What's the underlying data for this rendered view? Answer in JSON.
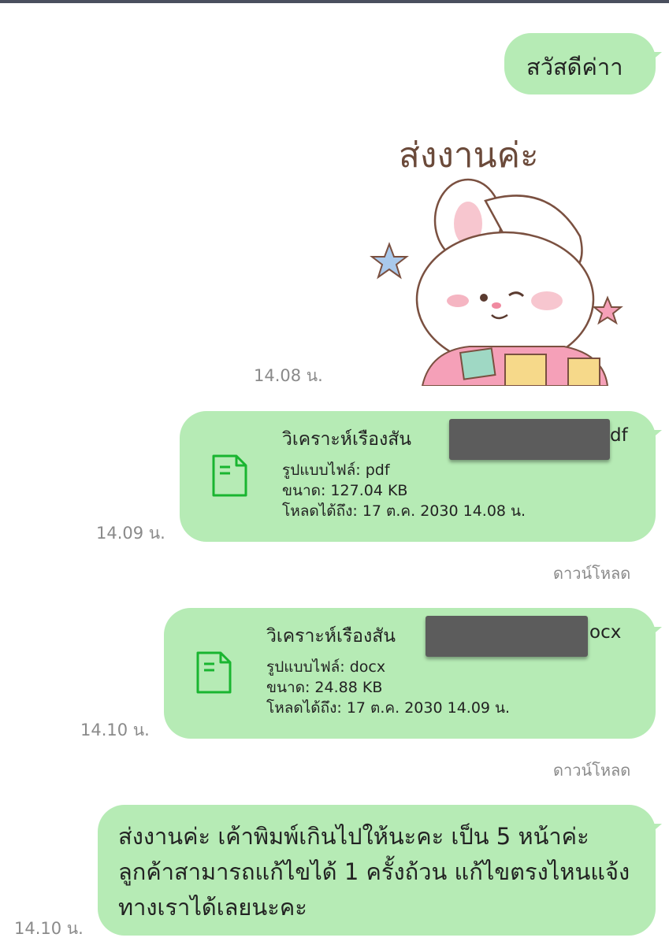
{
  "messages": [
    {
      "id": "greeting",
      "text": "สวัสดีค่าา"
    },
    {
      "id": "sticker",
      "text": "ส่งงานค่ะ",
      "time": "14.08 น."
    },
    {
      "id": "file1",
      "title_visible": "วิเคราะห์เรืองสัน",
      "suffix": "df",
      "type_line": "รูปแบบไฟล์: pdf",
      "size_line": "ขนาด: 127.04 KB",
      "expiry_line": "โหลดได้ถึง: 17 ต.ค. 2030 14.08 น.",
      "time": "14.09 น.",
      "download_label": "ดาวน์โหลด"
    },
    {
      "id": "file2",
      "title_visible": "วิเคราะห์เรืองสัน",
      "suffix": "ocx",
      "type_line": "รูปแบบไฟล์: docx",
      "size_line": "ขนาด: 24.88 KB",
      "expiry_line": "โหลดได้ถึง: 17 ต.ค. 2030 14.09 น.",
      "time": "14.10 น.",
      "download_label": "ดาวน์โหลด"
    },
    {
      "id": "note",
      "text": "ส่งงานค่ะ เค้าพิมพ์เกินไปให้นะคะ เป็น 5 หน้าค่ะ ลูกค้าสามารถแก้ไขได้ 1 ครั้งถ้วน แก้ไขตรงไหนแจ้งทางเราได้เลยนะคะ",
      "time": "14.10 น."
    }
  ],
  "colors": {
    "bubble": "#b6ebb5",
    "file_icon": "#19b530",
    "redaction": "#5c5c5c"
  },
  "icons": {
    "file": "document-file-icon"
  }
}
